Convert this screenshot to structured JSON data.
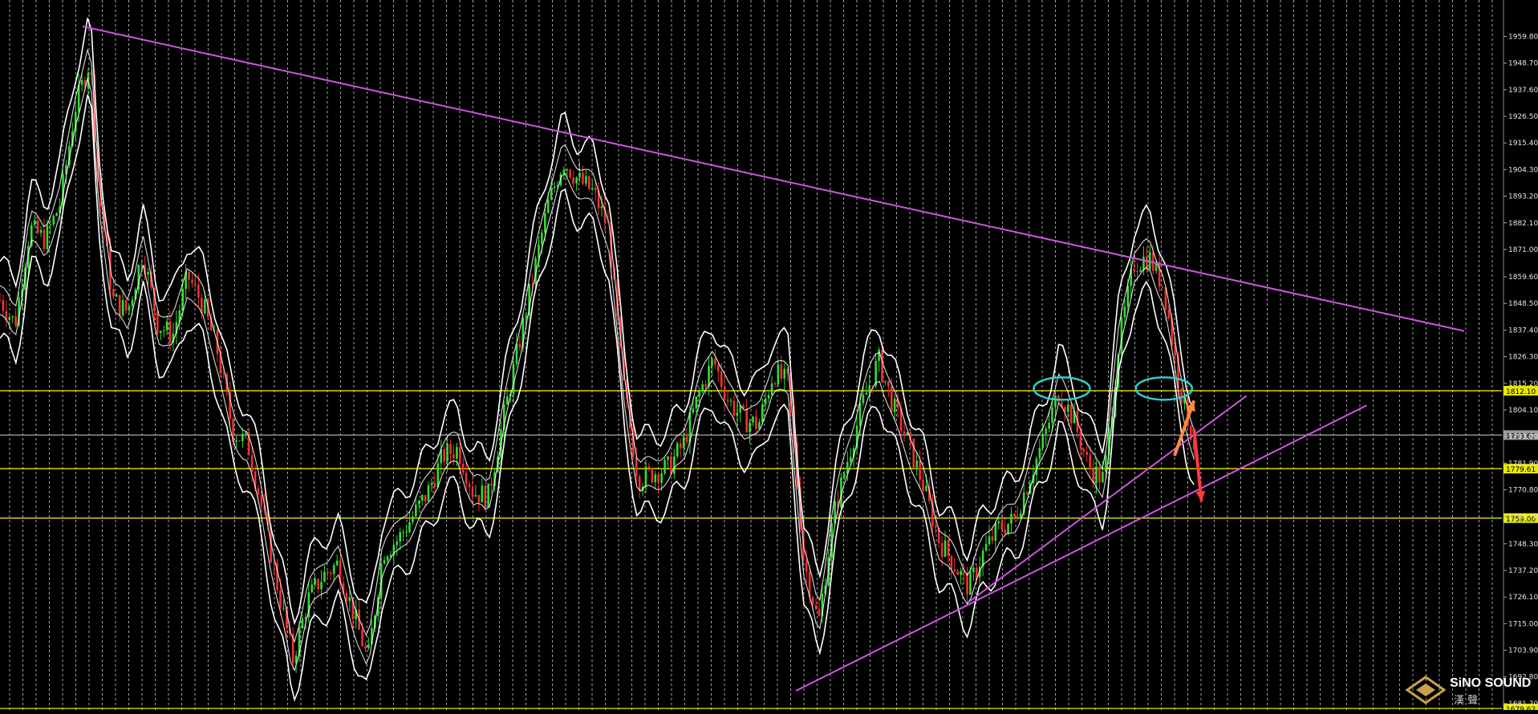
{
  "chart_data": {
    "type": "candlestick",
    "title": "",
    "xlabel": "",
    "ylabel": "",
    "ylim": [
      1679.0,
      1975.0
    ],
    "grid": true,
    "y_ticks": [
      "1959.80",
      "1948.70",
      "1937.60",
      "1926.50",
      "1915.40",
      "1904.30",
      "1893.20",
      "1882.10",
      "1871.00",
      "1859.60",
      "1848.50",
      "1837.40",
      "1826.30",
      "1815.20",
      "1804.10",
      "1793.00",
      "1781.90",
      "1770.80",
      "1759.70",
      "1748.30",
      "1737.20",
      "1726.10",
      "1715.00",
      "1703.90",
      "1692.80",
      "1681.70"
    ],
    "price_labels": [
      {
        "value": 1812.1,
        "text": "1812.10",
        "kind": "horizontal-level",
        "color": "#e8e800"
      },
      {
        "value": 1793.62,
        "text": "1793.62",
        "kind": "current-price",
        "color": "#9a9a9a"
      },
      {
        "value": 1779.61,
        "text": "1779.61",
        "kind": "horizontal-level",
        "color": "#e8e800"
      },
      {
        "value": 1759.0,
        "text": "1759.00",
        "kind": "horizontal-level",
        "color": "#e8e800"
      },
      {
        "value": 1679.62,
        "text": "1679.62",
        "kind": "horizontal-level",
        "color": "#e8e800"
      }
    ],
    "trendlines": [
      {
        "name": "descending-resistance",
        "from": [
          0.055,
          1964.0
        ],
        "to": [
          0.975,
          1837.0
        ],
        "color": "#cc55dd"
      },
      {
        "name": "rising-support-steep",
        "from": [
          0.645,
          1724.0
        ],
        "to": [
          0.83,
          1810.0
        ],
        "color": "#cc55dd"
      },
      {
        "name": "rising-support-long",
        "from": [
          0.53,
          1687.0
        ],
        "to": [
          0.91,
          1806.0
        ],
        "color": "#cc55dd"
      }
    ],
    "price_path": [
      [
        0.0,
        1850
      ],
      [
        0.01,
        1840
      ],
      [
        0.02,
        1880
      ],
      [
        0.03,
        1875
      ],
      [
        0.04,
        1890
      ],
      [
        0.05,
        1930
      ],
      [
        0.06,
        1950
      ],
      [
        0.065,
        1900
      ],
      [
        0.075,
        1850
      ],
      [
        0.085,
        1845
      ],
      [
        0.095,
        1870
      ],
      [
        0.105,
        1840
      ],
      [
        0.115,
        1835
      ],
      [
        0.125,
        1860
      ],
      [
        0.135,
        1848
      ],
      [
        0.145,
        1828
      ],
      [
        0.155,
        1795
      ],
      [
        0.165,
        1790
      ],
      [
        0.175,
        1762
      ],
      [
        0.185,
        1730
      ],
      [
        0.195,
        1700
      ],
      [
        0.205,
        1725
      ],
      [
        0.215,
        1735
      ],
      [
        0.225,
        1740
      ],
      [
        0.235,
        1720
      ],
      [
        0.245,
        1700
      ],
      [
        0.255,
        1745
      ],
      [
        0.265,
        1750
      ],
      [
        0.275,
        1760
      ],
      [
        0.285,
        1770
      ],
      [
        0.295,
        1785
      ],
      [
        0.305,
        1788
      ],
      [
        0.315,
        1770
      ],
      [
        0.325,
        1768
      ],
      [
        0.335,
        1800
      ],
      [
        0.345,
        1830
      ],
      [
        0.355,
        1860
      ],
      [
        0.365,
        1890
      ],
      [
        0.375,
        1908
      ],
      [
        0.385,
        1900
      ],
      [
        0.395,
        1895
      ],
      [
        0.405,
        1880
      ],
      [
        0.415,
        1815
      ],
      [
        0.425,
        1775
      ],
      [
        0.435,
        1778
      ],
      [
        0.445,
        1780
      ],
      [
        0.455,
        1790
      ],
      [
        0.465,
        1810
      ],
      [
        0.475,
        1825
      ],
      [
        0.485,
        1808
      ],
      [
        0.495,
        1800
      ],
      [
        0.505,
        1798
      ],
      [
        0.515,
        1820
      ],
      [
        0.525,
        1815
      ],
      [
        0.535,
        1742
      ],
      [
        0.545,
        1715
      ],
      [
        0.555,
        1760
      ],
      [
        0.565,
        1785
      ],
      [
        0.575,
        1808
      ],
      [
        0.585,
        1825
      ],
      [
        0.595,
        1805
      ],
      [
        0.605,
        1790
      ],
      [
        0.615,
        1772
      ],
      [
        0.625,
        1750
      ],
      [
        0.635,
        1740
      ],
      [
        0.645,
        1730
      ],
      [
        0.655,
        1745
      ],
      [
        0.665,
        1755
      ],
      [
        0.675,
        1758
      ],
      [
        0.685,
        1775
      ],
      [
        0.695,
        1792
      ],
      [
        0.705,
        1812
      ],
      [
        0.715,
        1800
      ],
      [
        0.725,
        1780
      ],
      [
        0.735,
        1775
      ],
      [
        0.745,
        1832
      ],
      [
        0.755,
        1865
      ],
      [
        0.765,
        1868
      ],
      [
        0.775,
        1855
      ],
      [
        0.785,
        1815
      ],
      [
        0.795,
        1790
      ]
    ],
    "annotations": [
      {
        "type": "ellipse",
        "at": [
          0.707,
          1813.0
        ],
        "color": "#33cccc"
      },
      {
        "type": "ellipse",
        "at": [
          0.775,
          1813.0
        ],
        "color": "#33cccc"
      },
      {
        "type": "arrow",
        "from": [
          0.782,
          1785.0
        ],
        "to": [
          0.795,
          1808.0
        ],
        "color": "#ff8a3d"
      },
      {
        "type": "arrow",
        "from": [
          0.795,
          1796.0
        ],
        "to": [
          0.8,
          1766.0
        ],
        "color": "#ff3b3b"
      }
    ]
  },
  "logo": {
    "title": "SiNO SOUND",
    "subtitle": "漢 聲"
  },
  "colors": {
    "background": "#000000",
    "grid": "#d9d9d9",
    "level_line": "#e8e800",
    "trendline": "#cc55dd",
    "bullish": "#33dd33",
    "bearish": "#ee3333",
    "envelope": "#ffffff"
  }
}
